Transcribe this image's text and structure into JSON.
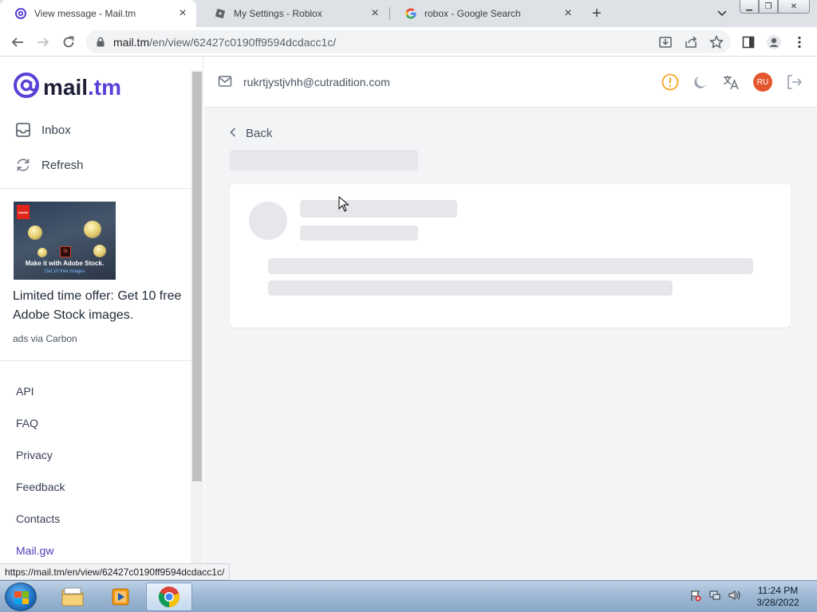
{
  "browser": {
    "tabs": [
      {
        "title": "View message - Mail.tm",
        "icon": "mailtm-at-icon",
        "active": true
      },
      {
        "title": "My Settings - Roblox",
        "icon": "roblox-icon",
        "active": false
      },
      {
        "title": "robox - Google Search",
        "icon": "google-icon",
        "active": false
      }
    ],
    "url_host": "mail.tm",
    "url_path": "/en/view/62427c0190ff9594dcdacc1c/",
    "status_url": "https://mail.tm/en/view/62427c0190ff9594dcdacc1c/"
  },
  "sidebar": {
    "brand": "mail",
    "brand_tld": ".tm",
    "nav": {
      "inbox": "Inbox",
      "refresh": "Refresh"
    },
    "ad": {
      "badge": "Adobe",
      "image_tagline": "Make it with Adobe Stock.",
      "image_subline": "Get 10 free images",
      "text": "Limited time offer: Get 10 free Adobe Stock images.",
      "via": "ads via Carbon"
    },
    "links": {
      "api": "API",
      "faq": "FAQ",
      "privacy": "Privacy",
      "feedback": "Feedback",
      "contacts": "Contacts",
      "mailgw": "Mail.gw"
    }
  },
  "header": {
    "email": "rukrtjystjvhh@cutradition.com",
    "avatar": "RU"
  },
  "main": {
    "back": "Back"
  },
  "taskbar": {
    "time": "11:24 PM",
    "date": "3/28/2022"
  },
  "colors": {
    "brand": "#5b3fd6",
    "avatar": "#e4572e",
    "warning": "#f5a623",
    "skeleton": "#e5e7eb"
  }
}
